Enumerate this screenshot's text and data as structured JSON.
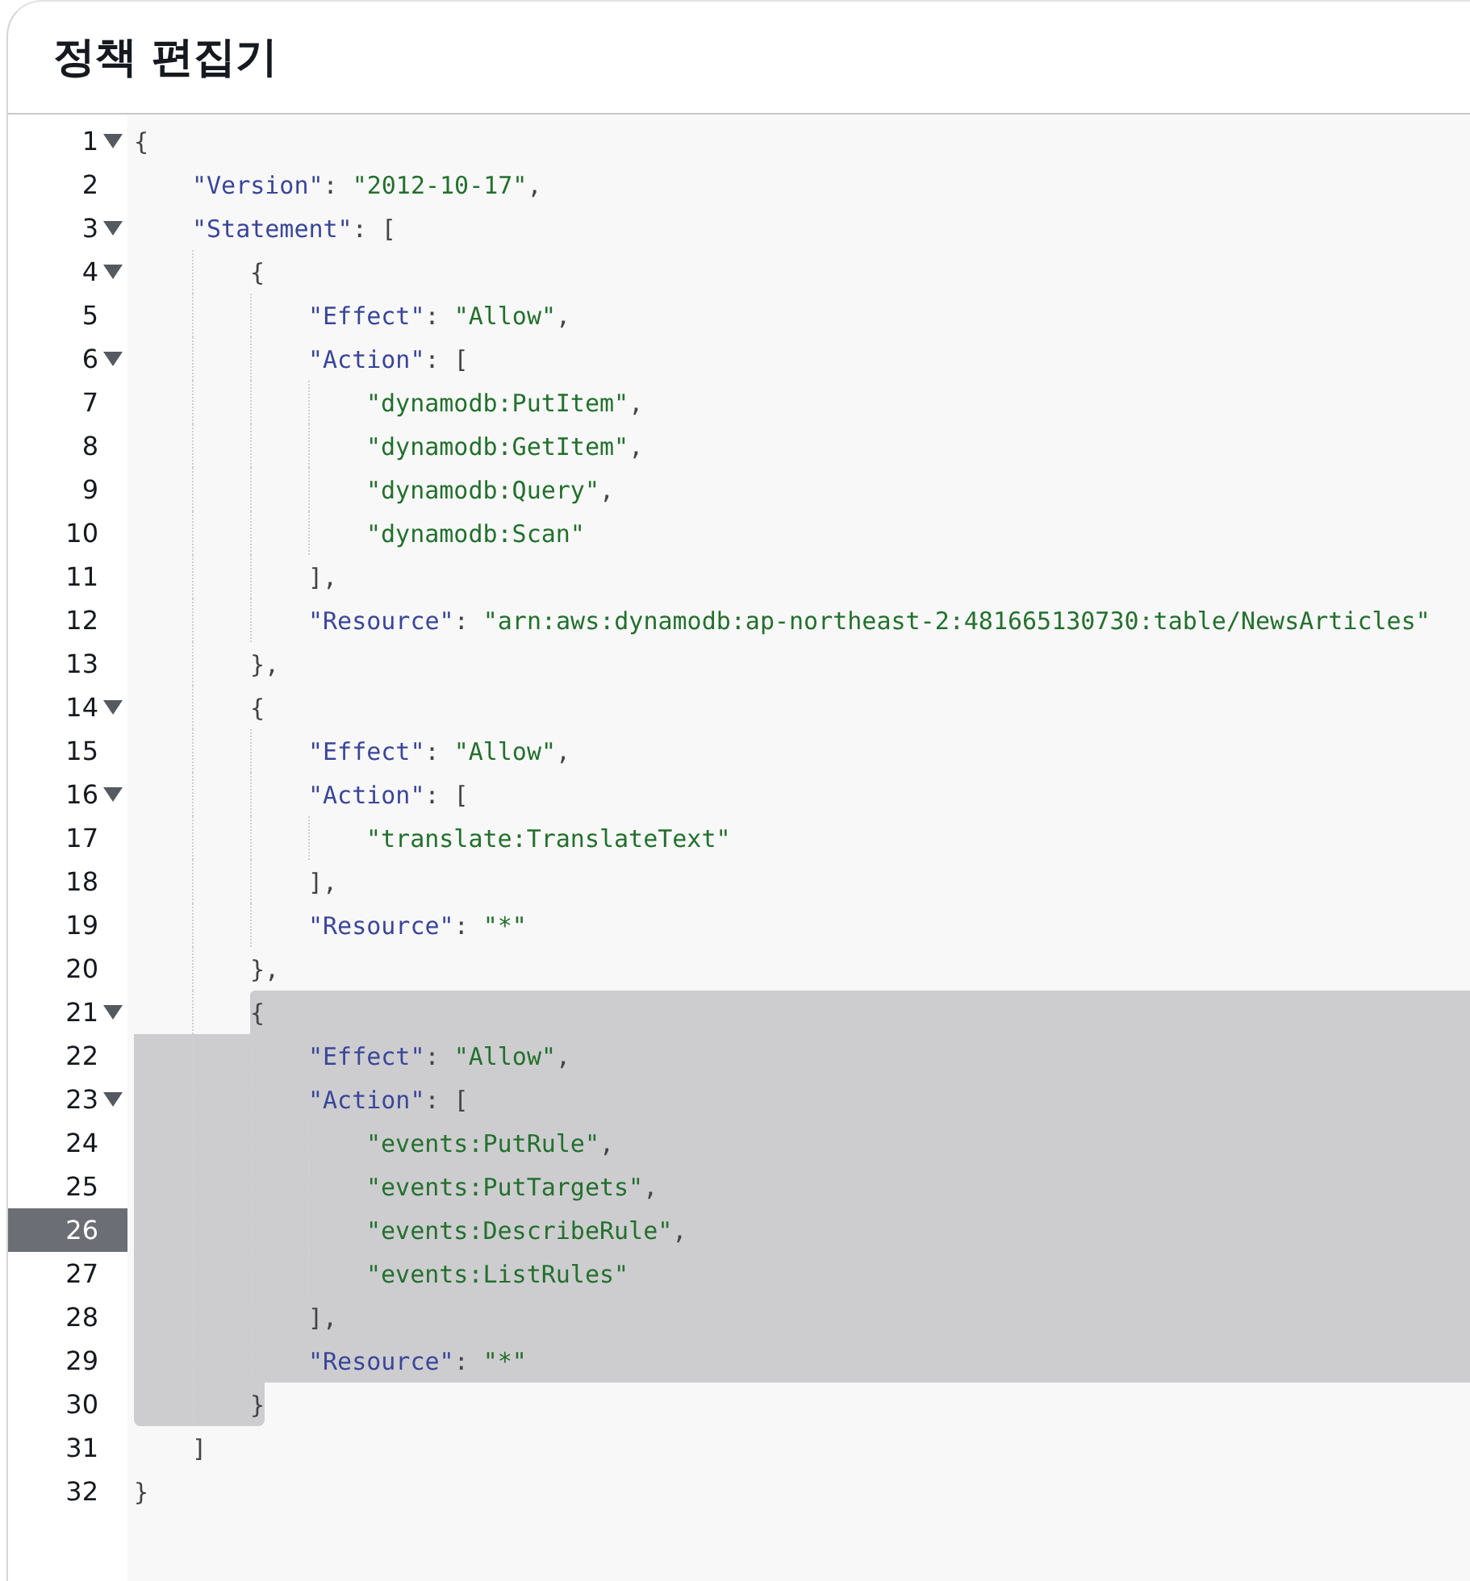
{
  "title": "정책 편집기",
  "lines": [
    {
      "number": "1",
      "code": "{",
      "fold": true,
      "active": false,
      "selected": false
    },
    {
      "number": "2",
      "code": "    \"Version\": \"2012-10-17\",",
      "fold": false,
      "active": false,
      "selected": false
    },
    {
      "number": "3",
      "code": "    \"Statement\": [",
      "fold": true,
      "active": false,
      "selected": false
    },
    {
      "number": "4",
      "code": "        {",
      "fold": true,
      "active": false,
      "selected": false
    },
    {
      "number": "5",
      "code": "            \"Effect\": \"Allow\",",
      "fold": false,
      "active": false,
      "selected": false
    },
    {
      "number": "6",
      "code": "            \"Action\": [",
      "fold": true,
      "active": false,
      "selected": false
    },
    {
      "number": "7",
      "code": "                \"dynamodb:PutItem\",",
      "fold": false,
      "active": false,
      "selected": false
    },
    {
      "number": "8",
      "code": "                \"dynamodb:GetItem\",",
      "fold": false,
      "active": false,
      "selected": false
    },
    {
      "number": "9",
      "code": "                \"dynamodb:Query\",",
      "fold": false,
      "active": false,
      "selected": false
    },
    {
      "number": "10",
      "code": "                \"dynamodb:Scan\"",
      "fold": false,
      "active": false,
      "selected": false
    },
    {
      "number": "11",
      "code": "            ],",
      "fold": false,
      "active": false,
      "selected": false
    },
    {
      "number": "12",
      "code": "            \"Resource\": \"arn:aws:dynamodb:ap-northeast-2:481665130730:table/NewsArticles\"",
      "fold": false,
      "active": false,
      "selected": false
    },
    {
      "number": "13",
      "code": "        },",
      "fold": false,
      "active": false,
      "selected": false
    },
    {
      "number": "14",
      "code": "        {",
      "fold": true,
      "active": false,
      "selected": false
    },
    {
      "number": "15",
      "code": "            \"Effect\": \"Allow\",",
      "fold": false,
      "active": false,
      "selected": false
    },
    {
      "number": "16",
      "code": "            \"Action\": [",
      "fold": true,
      "active": false,
      "selected": false
    },
    {
      "number": "17",
      "code": "                \"translate:TranslateText\"",
      "fold": false,
      "active": false,
      "selected": false
    },
    {
      "number": "18",
      "code": "            ],",
      "fold": false,
      "active": false,
      "selected": false
    },
    {
      "number": "19",
      "code": "            \"Resource\": \"*\"",
      "fold": false,
      "active": false,
      "selected": false
    },
    {
      "number": "20",
      "code": "        },",
      "fold": false,
      "active": false,
      "selected": false
    },
    {
      "number": "21",
      "code": "        {",
      "fold": true,
      "active": false,
      "selected": true
    },
    {
      "number": "22",
      "code": "            \"Effect\": \"Allow\",",
      "fold": false,
      "active": false,
      "selected": true
    },
    {
      "number": "23",
      "code": "            \"Action\": [",
      "fold": true,
      "active": false,
      "selected": true
    },
    {
      "number": "24",
      "code": "                \"events:PutRule\",",
      "fold": false,
      "active": false,
      "selected": true
    },
    {
      "number": "25",
      "code": "                \"events:PutTargets\",",
      "fold": false,
      "active": false,
      "selected": true
    },
    {
      "number": "26",
      "code": "                \"events:DescribeRule\",",
      "fold": false,
      "active": true,
      "selected": true
    },
    {
      "number": "27",
      "code": "                \"events:ListRules\"",
      "fold": false,
      "active": false,
      "selected": true
    },
    {
      "number": "28",
      "code": "            ],",
      "fold": false,
      "active": false,
      "selected": true
    },
    {
      "number": "29",
      "code": "            \"Resource\": \"*\"",
      "fold": false,
      "active": false,
      "selected": true
    },
    {
      "number": "30",
      "code": "        }",
      "fold": false,
      "active": false,
      "selected": true
    },
    {
      "number": "31",
      "code": "    ]",
      "fold": false,
      "active": false,
      "selected": false
    },
    {
      "number": "32",
      "code": "}",
      "fold": false,
      "active": false,
      "selected": false
    }
  ]
}
